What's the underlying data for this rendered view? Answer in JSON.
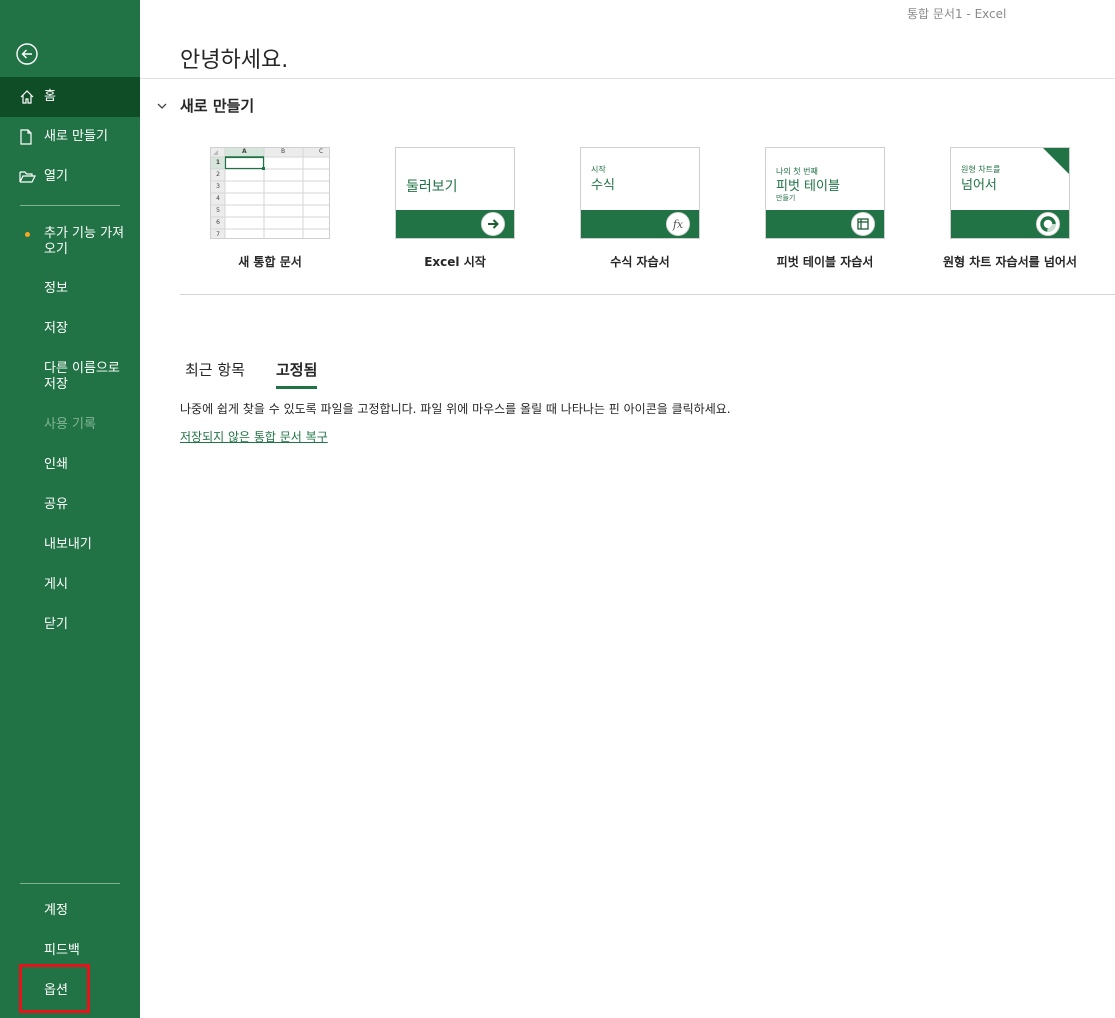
{
  "window": {
    "title": "통합 문서1  -  Excel"
  },
  "theme": {
    "sidebar_bg": "#217346",
    "active_item_bg": "#0f4d27",
    "accent": "#217346",
    "highlight_box": "#e8131a"
  },
  "sidebar": {
    "back_icon": "back-arrow-circle-icon",
    "items": [
      {
        "label": "홈",
        "icon": "home-icon"
      },
      {
        "label": "새로 만들기",
        "icon": "new-document-icon"
      },
      {
        "label": "열기",
        "icon": "open-folder-icon"
      },
      {
        "label": "추가 기능 가져\n오기"
      },
      {
        "label": "정보"
      },
      {
        "label": "저장"
      },
      {
        "label": "다른 이름으로\n저장"
      },
      {
        "label": "사용 기록"
      },
      {
        "label": "인쇄"
      },
      {
        "label": "공유"
      },
      {
        "label": "내보내기"
      },
      {
        "label": "게시"
      },
      {
        "label": "닫기"
      }
    ],
    "bottom_items": [
      {
        "label": "계정"
      },
      {
        "label": "피드백"
      },
      {
        "label": "옵션"
      }
    ]
  },
  "main": {
    "greeting": "안녕하세요.",
    "new_section": {
      "title": "새로 만들기"
    },
    "templates": [
      {
        "label": "새 통합 문서"
      },
      {
        "label": "Excel 시작",
        "thumb_title": "둘러보기"
      },
      {
        "label": "수식 자습서",
        "thumb_sub": "시작",
        "thumb_title": "수식"
      },
      {
        "label": "피벗 테이블 자습서",
        "thumb_sub": "나의 첫 번째",
        "thumb_title": "피벗 테이블",
        "thumb_sub2": "만들기"
      },
      {
        "label": "원형 차트 자습서를 넘어서",
        "thumb_sub": "원형 차트를",
        "thumb_title": "넘어서"
      }
    ],
    "spreadsheet_preview": {
      "columns": [
        "A",
        "B",
        "C"
      ],
      "rows": [
        "1",
        "2",
        "3",
        "4",
        "5",
        "6",
        "7"
      ]
    },
    "tabs": [
      {
        "label": "최근 항목"
      },
      {
        "label": "고정됨"
      }
    ],
    "pinned_message": "나중에 쉽게 찾을 수 있도록 파일을 고정합니다. 파일 위에 마우스를 올릴 때 나타나는 핀 아이콘을 클릭하세요.",
    "recover_link": "저장되지 않은 통합 문서 복구"
  }
}
